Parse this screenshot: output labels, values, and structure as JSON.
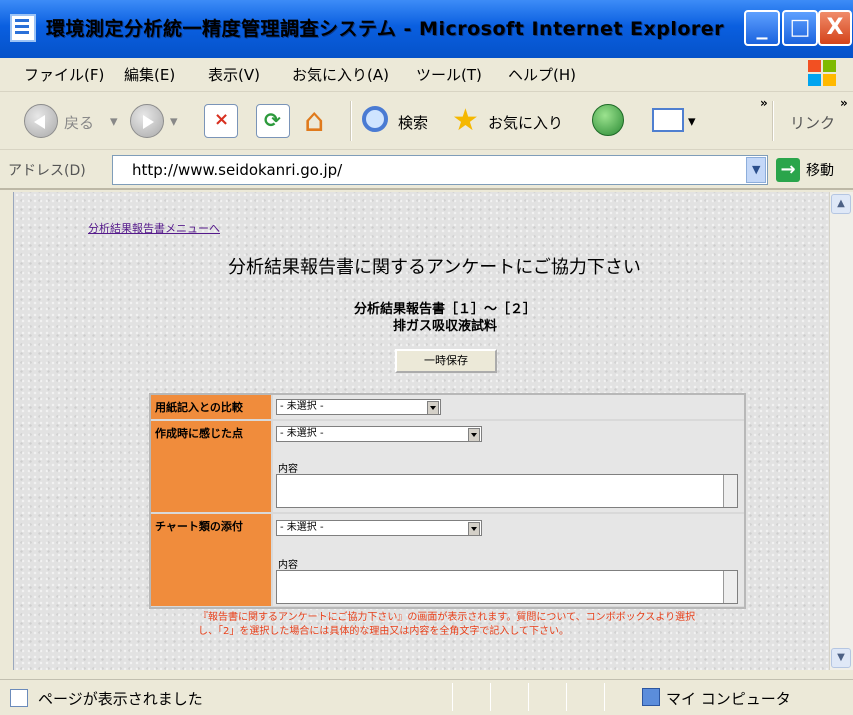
{
  "window": {
    "title": "環境測定分析統一精度管理調査システム - Microsoft Internet Explorer",
    "minimize": "_",
    "maximize": "□",
    "close": "X"
  },
  "menu": [
    "ファイル(F)",
    "編集(E)",
    "表示(V)",
    "お気に入り(A)",
    "ツール(T)",
    "ヘルプ(H)"
  ],
  "toolbar": {
    "back": "戻る",
    "search": "検索",
    "favorites": "お気に入り",
    "chevron": "»",
    "links_chevron": "»",
    "links": "リンク"
  },
  "address": {
    "label": "アドレス(D)",
    "url": "http://www.seidokanri.go.jp/",
    "go_label": "移動"
  },
  "page": {
    "back_link": "分析結果報告書メニューへ",
    "headline": "分析結果報告書に関するアンケートにご協力下さい",
    "subtitle_line1": "分析結果報告書［１］〜［２］",
    "subtitle_line2": "排ガス吸収液試料",
    "save_button": "一時保存",
    "survey": {
      "rows": [
        {
          "label": "用紙記入との比較",
          "select": "- 未選択 -"
        },
        {
          "label": "作成時に感じた点",
          "select": "- 未選択 -",
          "content_label": "内容"
        },
        {
          "label": "チャート類の添付",
          "select": "- 未選択 -",
          "content_label": "内容"
        }
      ]
    },
    "note": "『報告書に関するアンケートにご協力下さい』の画面が表示されます。質問について、コンボボックスより選択し、「2」を選択した場合には具体的な理由又は内容を全角文字で記入して下さい。"
  },
  "status": {
    "text": "ページが表示されました",
    "zone": "マイ コンピュータ"
  },
  "colors": {
    "titlebar": "#0a5fe0",
    "label_bg": "#f08c3c",
    "note_text": "#e8401a"
  }
}
